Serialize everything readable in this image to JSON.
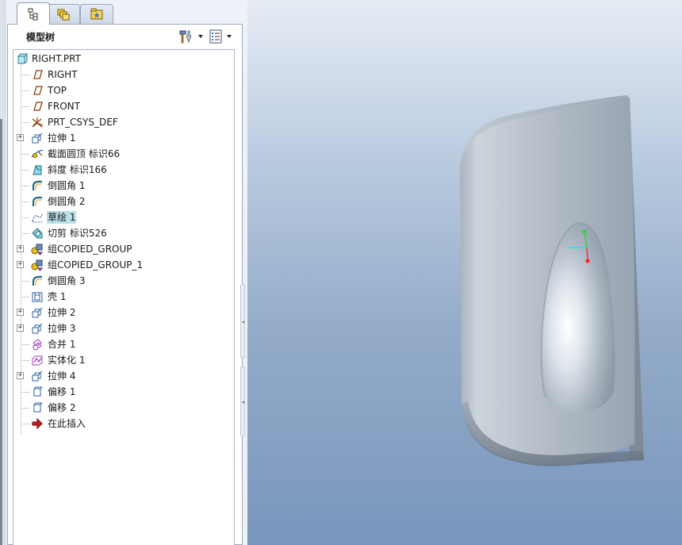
{
  "tabs": [
    {
      "icon": "model-tree-tab-icon",
      "active": true
    },
    {
      "icon": "layers-tab-icon",
      "active": false
    },
    {
      "icon": "favorites-tab-icon",
      "active": false
    }
  ],
  "header": {
    "title": "模型树",
    "settings_icon": "settings-hammer-icon",
    "show_icon": "show-list-icon"
  },
  "tree": {
    "root": {
      "label": "RIGHT.PRT",
      "icon": "part-icon"
    },
    "items": [
      {
        "label": "RIGHT",
        "icon": "datum-plane-icon",
        "expandable": false,
        "selected": false
      },
      {
        "label": "TOP",
        "icon": "datum-plane-icon",
        "expandable": false,
        "selected": false
      },
      {
        "label": "FRONT",
        "icon": "datum-plane-icon",
        "expandable": false,
        "selected": false
      },
      {
        "label": "PRT_CSYS_DEF",
        "icon": "coordinate-system-icon",
        "expandable": false,
        "selected": false
      },
      {
        "label": "拉伸 1",
        "icon": "extrude-icon",
        "expandable": true,
        "selected": false
      },
      {
        "label": "截面圆顶 标识66",
        "icon": "section-dome-icon",
        "expandable": false,
        "selected": false
      },
      {
        "label": "斜度 标识166",
        "icon": "draft-icon",
        "expandable": false,
        "selected": false
      },
      {
        "label": "倒圆角 1",
        "icon": "round-icon",
        "expandable": false,
        "selected": false
      },
      {
        "label": "倒圆角 2",
        "icon": "round-icon",
        "expandable": false,
        "selected": false
      },
      {
        "label": "草绘 1",
        "icon": "sketch-icon",
        "expandable": false,
        "selected": true
      },
      {
        "label": "切剪 标识526",
        "icon": "cut-icon",
        "expandable": false,
        "selected": false
      },
      {
        "label": "组COPIED_GROUP",
        "icon": "group-icon",
        "expandable": true,
        "selected": false
      },
      {
        "label": "组COPIED_GROUP_1",
        "icon": "group-icon",
        "expandable": true,
        "selected": false
      },
      {
        "label": "倒圆角 3",
        "icon": "round-icon",
        "expandable": false,
        "selected": false
      },
      {
        "label": "壳 1",
        "icon": "shell-icon",
        "expandable": false,
        "selected": false
      },
      {
        "label": "拉伸 2",
        "icon": "extrude-icon",
        "expandable": true,
        "selected": false
      },
      {
        "label": "拉伸 3",
        "icon": "extrude-icon",
        "expandable": true,
        "selected": false
      },
      {
        "label": "合并 1",
        "icon": "merge-icon",
        "expandable": false,
        "selected": false
      },
      {
        "label": "实体化 1",
        "icon": "solidify-icon",
        "expandable": false,
        "selected": false
      },
      {
        "label": "拉伸 4",
        "icon": "extrude-icon",
        "expandable": true,
        "selected": false
      },
      {
        "label": "偏移 1",
        "icon": "offset-icon",
        "expandable": false,
        "selected": false
      },
      {
        "label": "偏移 2",
        "icon": "offset-icon",
        "expandable": false,
        "selected": false
      },
      {
        "label": "在此插入",
        "icon": "insert-here-arrow-icon",
        "expandable": false,
        "selected": false
      }
    ]
  },
  "viewport": {
    "model_icon": "shaded-part-model",
    "csys_axes_colors": {
      "x": "#00e5ff",
      "y": "#22dd22",
      "z": "#ff2222"
    }
  },
  "colors": {
    "selection": "#b8dfe8",
    "background_top": "#e6ecf4",
    "background_bottom": "#7996bd"
  }
}
